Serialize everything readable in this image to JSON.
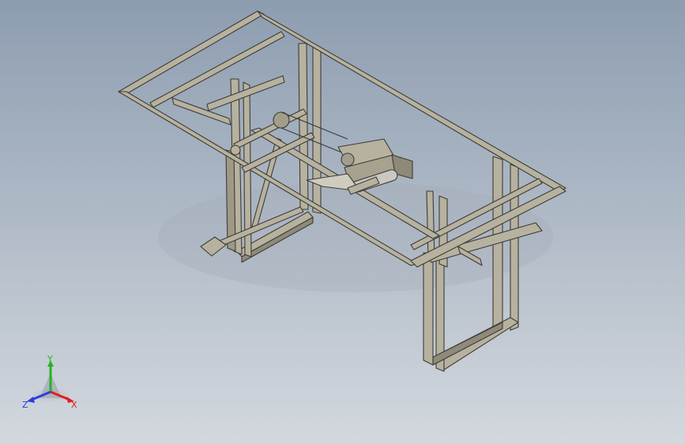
{
  "viewport": {
    "background_top": "#8d9db0",
    "background_bottom": "#d3d8de",
    "model_fill": "#b7b29f",
    "model_edge": "#3d3c36",
    "shadow": "#9aa3ad"
  },
  "triad": {
    "x_label": "X",
    "y_label": "Y",
    "z_label": "Z",
    "x_color": "#e0201b",
    "y_color": "#25b325",
    "z_color": "#2a3fe0"
  }
}
